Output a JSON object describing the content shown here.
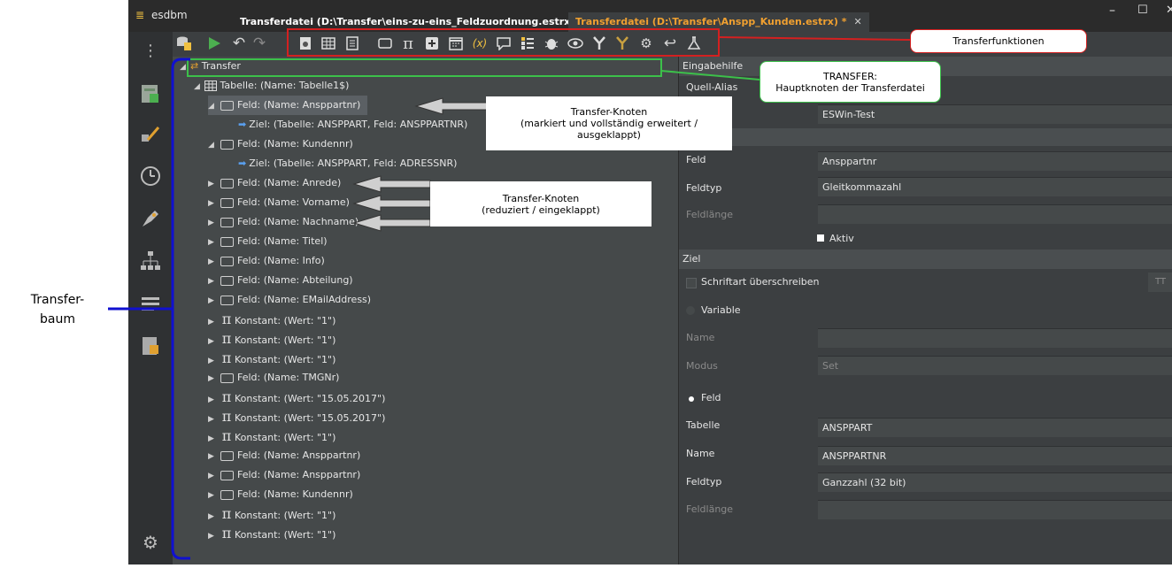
{
  "app": {
    "title": "esdbm"
  },
  "tabs": [
    {
      "label": "Transferdatei (D:\\Transfer\\eins-zu-eins_Feldzuordnung.estrx) *",
      "color": "#ffffff"
    },
    {
      "label": "Transferdatei (D:\\Transfer\\Anspp_Kunden.estrx) *",
      "color": "#f0a030"
    }
  ],
  "window_controls": {
    "minimize": "–",
    "maximize": "☐",
    "close": "✕"
  },
  "toolbar": {
    "icons": [
      "database-list-icon",
      "run-icon",
      "undo-icon",
      "redo-icon",
      "settings-doc-icon",
      "table-icon",
      "list-doc-icon",
      "field-icon",
      "constant-pi-icon",
      "add-box-icon",
      "calendar-icon",
      "variable-icon",
      "comment-icon",
      "list-icon",
      "bug-icon",
      "eye-icon",
      "merge-icon",
      "split-icon",
      "gear-icon",
      "return-icon",
      "flask-icon"
    ]
  },
  "tree": {
    "root": "Transfer",
    "table": "Tabelle: (Name: Tabelle1$)",
    "rows": [
      {
        "kind": "field",
        "label": "Feld: (Name: Ansppartnr)",
        "expanded": true,
        "selected": true
      },
      {
        "kind": "target",
        "label": "Ziel: (Tabelle: ANSPPART, Feld: ANSPPARTNR)"
      },
      {
        "kind": "field",
        "label": "Feld: (Name: Kundennr)",
        "expanded": true
      },
      {
        "kind": "target",
        "label": "Ziel: (Tabelle: ANSPPART, Feld: ADRESSNR)"
      },
      {
        "kind": "field",
        "label": "Feld: (Name: Anrede)"
      },
      {
        "kind": "field",
        "label": "Feld: (Name: Vorname)"
      },
      {
        "kind": "field",
        "label": "Feld: (Name: Nachname)"
      },
      {
        "kind": "field",
        "label": "Feld: (Name: Titel)"
      },
      {
        "kind": "field",
        "label": "Feld: (Name: Info)"
      },
      {
        "kind": "field",
        "label": "Feld: (Name: Abteilung)"
      },
      {
        "kind": "field",
        "label": "Feld: (Name: EMailAddress)"
      },
      {
        "kind": "const",
        "label": "Konstant: (Wert: \"1\")"
      },
      {
        "kind": "const",
        "label": "Konstant: (Wert: \"1\")"
      },
      {
        "kind": "const",
        "label": "Konstant: (Wert: \"1\")"
      },
      {
        "kind": "field",
        "label": "Feld: (Name: TMGNr)"
      },
      {
        "kind": "const",
        "label": "Konstant: (Wert: \"15.05.2017\")"
      },
      {
        "kind": "const",
        "label": "Konstant: (Wert: \"15.05.2017\")"
      },
      {
        "kind": "const",
        "label": "Konstant: (Wert: \"1\")"
      },
      {
        "kind": "field",
        "label": "Feld: (Name: Ansppartnr)"
      },
      {
        "kind": "field",
        "label": "Feld: (Name: Ansppartnr)"
      },
      {
        "kind": "field",
        "label": "Feld: (Name: Kundennr)"
      },
      {
        "kind": "const",
        "label": "Konstant: (Wert: \"1\")"
      },
      {
        "kind": "const",
        "label": "Konstant: (Wert: \"1\")"
      }
    ]
  },
  "props": {
    "section_eingabehilfe": "Eingabehilfe",
    "quell_alias_label": "Quell-Alias",
    "quell_alias_value": "ESWin-Test",
    "feld_label": "Feld",
    "feld_value": "Ansppartnr",
    "feldtyp_label": "Feldtyp",
    "feldtyp_value": "Gleitkommazahl",
    "feldlaenge_label": "Feldlänge",
    "aktiv_label": "Aktiv",
    "section_ziel": "Ziel",
    "schriftart_label": "Schriftart überschreiben",
    "variable_label": "Variable",
    "name_label": "Name",
    "modus_label": "Modus",
    "modus_value": "Set",
    "feld_radio_label": "Feld",
    "tabelle_label": "Tabelle",
    "tabelle_value": "ANSPPART",
    "ziel_name_label": "Name",
    "ziel_name_value": "ANSPPARTNR",
    "ziel_feldtyp_label": "Feldtyp",
    "ziel_feldtyp_value": "Ganzzahl (32 bit)",
    "ziel_feldlaenge_label": "Feldlänge",
    "font_icon_text": "TT"
  },
  "annotations": {
    "transferfunktionen": "Transferfunktionen",
    "transfer_title": "TRANSFER:",
    "transfer_sub": "Hauptknoten der Transferdatei",
    "knoten1_title": "Transfer-Knoten",
    "knoten1_sub": "(markiert und vollständig erweitert / ausgeklappt)",
    "knoten2_title": "Transfer-Knoten",
    "knoten2_sub": "(reduziert / eingeklappt)",
    "baum_line1": "Transfer-",
    "baum_line2": "baum"
  },
  "colors": {
    "accent_red": "#d42020",
    "accent_green": "#3cc04a",
    "accent_blue": "#1010d0",
    "tab_active": "#f0a030"
  }
}
